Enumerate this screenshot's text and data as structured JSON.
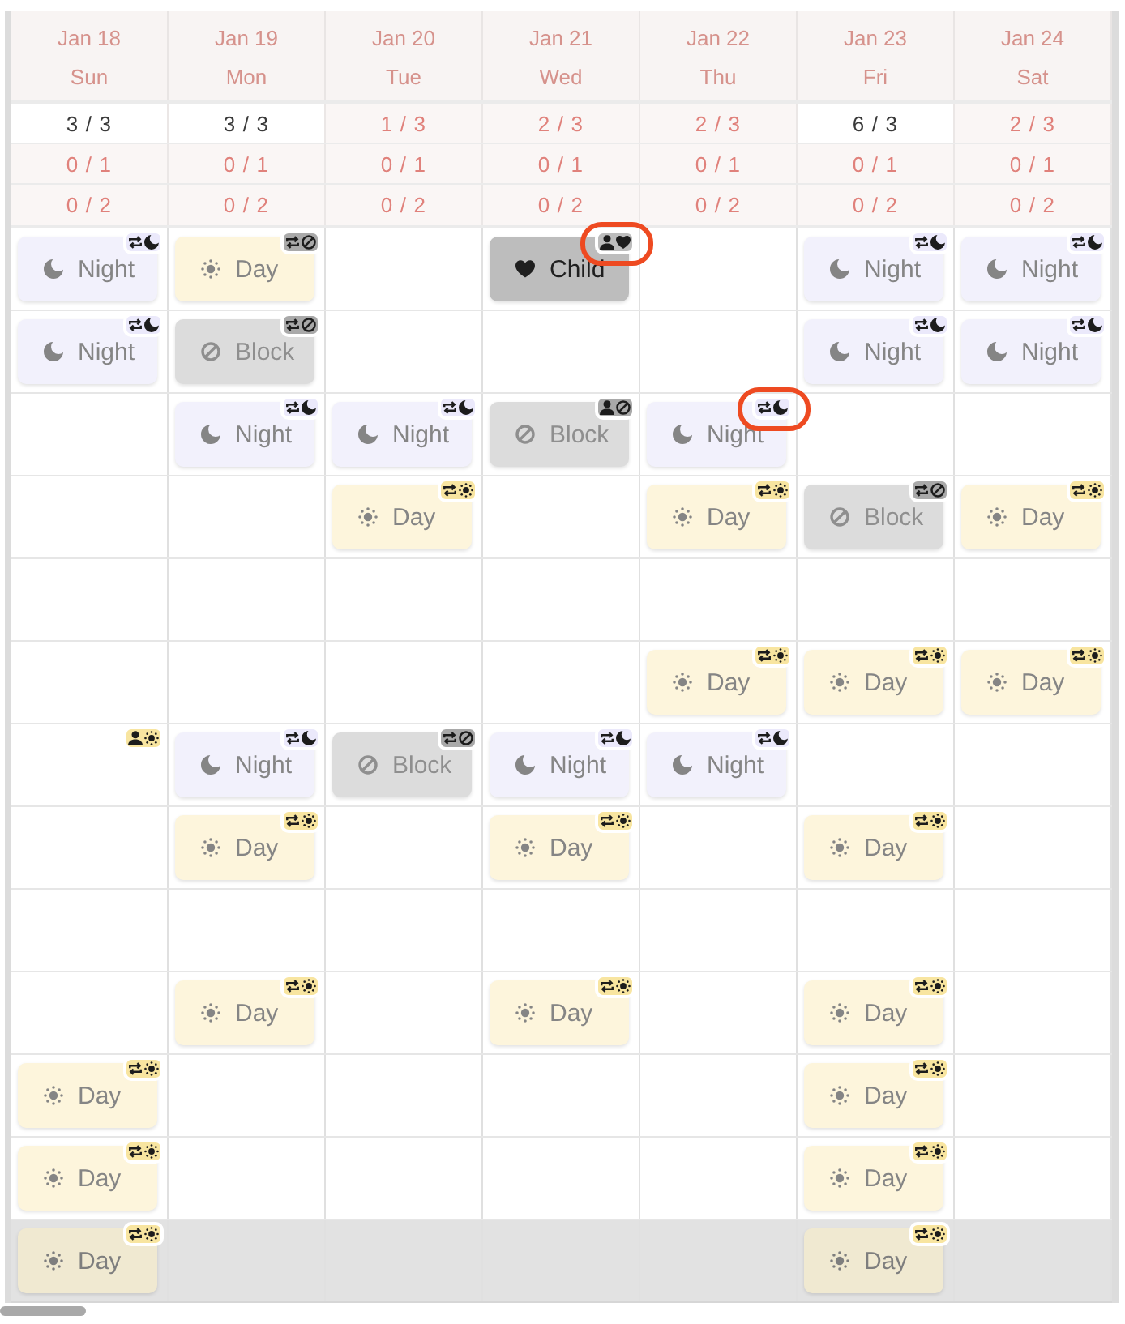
{
  "days": [
    {
      "date": "Jan 18",
      "weekday": "Sun",
      "counts": [
        {
          "text": "3 / 3",
          "met": true
        },
        {
          "text": "0 / 1",
          "met": false
        },
        {
          "text": "0 / 2",
          "met": false
        }
      ]
    },
    {
      "date": "Jan 19",
      "weekday": "Mon",
      "counts": [
        {
          "text": "3 / 3",
          "met": true
        },
        {
          "text": "0 / 1",
          "met": false
        },
        {
          "text": "0 / 2",
          "met": false
        }
      ]
    },
    {
      "date": "Jan 20",
      "weekday": "Tue",
      "counts": [
        {
          "text": "1 / 3",
          "met": false
        },
        {
          "text": "0 / 1",
          "met": false
        },
        {
          "text": "0 / 2",
          "met": false
        }
      ]
    },
    {
      "date": "Jan 21",
      "weekday": "Wed",
      "counts": [
        {
          "text": "2 / 3",
          "met": false
        },
        {
          "text": "0 / 1",
          "met": false
        },
        {
          "text": "0 / 2",
          "met": false
        }
      ]
    },
    {
      "date": "Jan 22",
      "weekday": "Thu",
      "counts": [
        {
          "text": "2 / 3",
          "met": false
        },
        {
          "text": "0 / 1",
          "met": false
        },
        {
          "text": "0 / 2",
          "met": false
        }
      ]
    },
    {
      "date": "Jan 23",
      "weekday": "Fri",
      "counts": [
        {
          "text": "6 / 3",
          "met": true
        },
        {
          "text": "0 / 1",
          "met": false
        },
        {
          "text": "0 / 2",
          "met": false
        }
      ]
    },
    {
      "date": "Jan 24",
      "weekday": "Sat",
      "counts": [
        {
          "text": "2 / 3",
          "met": false
        },
        {
          "text": "0 / 1",
          "met": false
        },
        {
          "text": "0 / 2",
          "met": false
        }
      ]
    }
  ],
  "rows": [
    {
      "shaded": false,
      "cells": [
        {
          "kind": "night",
          "label": "Night",
          "badge": [
            {
              "kind": "repeat"
            },
            {
              "kind": "moon"
            }
          ],
          "highlighted": false
        },
        {
          "kind": "day",
          "label": "Day",
          "badge": [
            {
              "kind": "repeat"
            },
            {
              "kind": "prohibited"
            }
          ],
          "highlighted": false
        },
        {
          "kind": "empty"
        },
        {
          "kind": "child",
          "label": "Child",
          "badge": [
            {
              "kind": "person"
            },
            {
              "kind": "heart"
            }
          ],
          "highlighted": true
        },
        {
          "kind": "empty"
        },
        {
          "kind": "night",
          "label": "Night",
          "badge": [
            {
              "kind": "repeat"
            },
            {
              "kind": "moon"
            }
          ],
          "highlighted": false
        },
        {
          "kind": "night",
          "label": "Night",
          "badge": [
            {
              "kind": "repeat"
            },
            {
              "kind": "moon"
            }
          ],
          "highlighted": false
        }
      ]
    },
    {
      "shaded": false,
      "cells": [
        {
          "kind": "night",
          "label": "Night",
          "badge": [
            {
              "kind": "repeat"
            },
            {
              "kind": "moon"
            }
          ],
          "highlighted": false
        },
        {
          "kind": "block",
          "label": "Block",
          "badge": [
            {
              "kind": "repeat"
            },
            {
              "kind": "prohibited"
            }
          ],
          "highlighted": false
        },
        {
          "kind": "empty"
        },
        {
          "kind": "empty"
        },
        {
          "kind": "empty"
        },
        {
          "kind": "night",
          "label": "Night",
          "badge": [
            {
              "kind": "repeat"
            },
            {
              "kind": "moon"
            }
          ],
          "highlighted": false
        },
        {
          "kind": "night",
          "label": "Night",
          "badge": [
            {
              "kind": "repeat"
            },
            {
              "kind": "moon"
            }
          ],
          "highlighted": false
        }
      ]
    },
    {
      "shaded": false,
      "cells": [
        {
          "kind": "empty"
        },
        {
          "kind": "night",
          "label": "Night",
          "badge": [
            {
              "kind": "repeat"
            },
            {
              "kind": "moon"
            }
          ],
          "highlighted": false
        },
        {
          "kind": "night",
          "label": "Night",
          "badge": [
            {
              "kind": "repeat"
            },
            {
              "kind": "moon"
            }
          ],
          "highlighted": false
        },
        {
          "kind": "block",
          "label": "Block",
          "badge": [
            {
              "kind": "person"
            },
            {
              "kind": "prohibited"
            }
          ],
          "highlighted": false
        },
        {
          "kind": "night",
          "label": "Night",
          "badge": [
            {
              "kind": "repeat"
            },
            {
              "kind": "moon"
            }
          ],
          "highlighted": true
        },
        {
          "kind": "empty"
        },
        {
          "kind": "empty"
        }
      ]
    },
    {
      "shaded": false,
      "cells": [
        {
          "kind": "empty"
        },
        {
          "kind": "empty"
        },
        {
          "kind": "day",
          "label": "Day",
          "badge": [
            {
              "kind": "repeat"
            },
            {
              "kind": "sun"
            }
          ],
          "highlighted": false
        },
        {
          "kind": "empty"
        },
        {
          "kind": "day",
          "label": "Day",
          "badge": [
            {
              "kind": "repeat"
            },
            {
              "kind": "sun"
            }
          ],
          "highlighted": false
        },
        {
          "kind": "block",
          "label": "Block",
          "badge": [
            {
              "kind": "repeat"
            },
            {
              "kind": "prohibited"
            }
          ],
          "highlighted": false
        },
        {
          "kind": "day",
          "label": "Day",
          "badge": [
            {
              "kind": "repeat"
            },
            {
              "kind": "sun"
            }
          ],
          "highlighted": false
        }
      ]
    },
    {
      "shaded": false,
      "cells": [
        {
          "kind": "empty"
        },
        {
          "kind": "empty"
        },
        {
          "kind": "empty"
        },
        {
          "kind": "empty"
        },
        {
          "kind": "empty"
        },
        {
          "kind": "empty"
        },
        {
          "kind": "empty"
        }
      ]
    },
    {
      "shaded": false,
      "cells": [
        {
          "kind": "empty"
        },
        {
          "kind": "empty"
        },
        {
          "kind": "empty"
        },
        {
          "kind": "empty"
        },
        {
          "kind": "day",
          "label": "Day",
          "badge": [
            {
              "kind": "repeat"
            },
            {
              "kind": "sun"
            }
          ],
          "highlighted": false
        },
        {
          "kind": "day",
          "label": "Day",
          "badge": [
            {
              "kind": "repeat"
            },
            {
              "kind": "sun"
            }
          ],
          "highlighted": false
        },
        {
          "kind": "day",
          "label": "Day",
          "badge": [
            {
              "kind": "repeat"
            },
            {
              "kind": "sun"
            }
          ],
          "highlighted": false
        }
      ]
    },
    {
      "shaded": false,
      "cells": [
        {
          "kind": "marker",
          "badge": [
            {
              "kind": "person"
            },
            {
              "kind": "sun"
            }
          ]
        },
        {
          "kind": "night",
          "label": "Night",
          "badge": [
            {
              "kind": "repeat"
            },
            {
              "kind": "moon"
            }
          ],
          "highlighted": false
        },
        {
          "kind": "block",
          "label": "Block",
          "badge": [
            {
              "kind": "repeat"
            },
            {
              "kind": "prohibited"
            }
          ],
          "highlighted": false
        },
        {
          "kind": "night",
          "label": "Night",
          "badge": [
            {
              "kind": "repeat"
            },
            {
              "kind": "moon"
            }
          ],
          "highlighted": false
        },
        {
          "kind": "night",
          "label": "Night",
          "badge": [
            {
              "kind": "repeat"
            },
            {
              "kind": "moon"
            }
          ],
          "highlighted": false
        },
        {
          "kind": "empty"
        },
        {
          "kind": "empty"
        }
      ]
    },
    {
      "shaded": false,
      "cells": [
        {
          "kind": "empty"
        },
        {
          "kind": "day",
          "label": "Day",
          "badge": [
            {
              "kind": "repeat"
            },
            {
              "kind": "sun"
            }
          ],
          "highlighted": false
        },
        {
          "kind": "empty"
        },
        {
          "kind": "day",
          "label": "Day",
          "badge": [
            {
              "kind": "repeat"
            },
            {
              "kind": "sun"
            }
          ],
          "highlighted": false
        },
        {
          "kind": "empty"
        },
        {
          "kind": "day",
          "label": "Day",
          "badge": [
            {
              "kind": "repeat"
            },
            {
              "kind": "sun"
            }
          ],
          "highlighted": false
        },
        {
          "kind": "empty"
        }
      ]
    },
    {
      "shaded": false,
      "cells": [
        {
          "kind": "empty"
        },
        {
          "kind": "empty"
        },
        {
          "kind": "empty"
        },
        {
          "kind": "empty"
        },
        {
          "kind": "empty"
        },
        {
          "kind": "empty"
        },
        {
          "kind": "empty"
        }
      ]
    },
    {
      "shaded": false,
      "cells": [
        {
          "kind": "empty"
        },
        {
          "kind": "day",
          "label": "Day",
          "badge": [
            {
              "kind": "repeat"
            },
            {
              "kind": "sun"
            }
          ],
          "highlighted": false
        },
        {
          "kind": "empty"
        },
        {
          "kind": "day",
          "label": "Day",
          "badge": [
            {
              "kind": "repeat"
            },
            {
              "kind": "sun"
            }
          ],
          "highlighted": false
        },
        {
          "kind": "empty"
        },
        {
          "kind": "day",
          "label": "Day",
          "badge": [
            {
              "kind": "repeat"
            },
            {
              "kind": "sun"
            }
          ],
          "highlighted": false
        },
        {
          "kind": "empty"
        }
      ]
    },
    {
      "shaded": false,
      "cells": [
        {
          "kind": "day",
          "label": "Day",
          "badge": [
            {
              "kind": "repeat"
            },
            {
              "kind": "sun"
            }
          ],
          "highlighted": false
        },
        {
          "kind": "empty"
        },
        {
          "kind": "empty"
        },
        {
          "kind": "empty"
        },
        {
          "kind": "empty"
        },
        {
          "kind": "day",
          "label": "Day",
          "badge": [
            {
              "kind": "repeat"
            },
            {
              "kind": "sun"
            }
          ],
          "highlighted": false
        },
        {
          "kind": "empty"
        }
      ]
    },
    {
      "shaded": false,
      "cells": [
        {
          "kind": "day",
          "label": "Day",
          "badge": [
            {
              "kind": "repeat"
            },
            {
              "kind": "sun"
            }
          ],
          "highlighted": false
        },
        {
          "kind": "empty"
        },
        {
          "kind": "empty"
        },
        {
          "kind": "empty"
        },
        {
          "kind": "empty"
        },
        {
          "kind": "day",
          "label": "Day",
          "badge": [
            {
              "kind": "repeat"
            },
            {
              "kind": "sun"
            }
          ],
          "highlighted": false
        },
        {
          "kind": "empty"
        }
      ]
    },
    {
      "shaded": true,
      "cells": [
        {
          "kind": "day",
          "label": "Day",
          "badge": [
            {
              "kind": "repeat"
            },
            {
              "kind": "sun"
            }
          ],
          "highlighted": false
        },
        {
          "kind": "empty"
        },
        {
          "kind": "empty"
        },
        {
          "kind": "empty"
        },
        {
          "kind": "empty"
        },
        {
          "kind": "day",
          "label": "Day",
          "badge": [
            {
              "kind": "repeat"
            },
            {
              "kind": "sun"
            }
          ],
          "highlighted": false
        },
        {
          "kind": "empty"
        }
      ]
    }
  ]
}
